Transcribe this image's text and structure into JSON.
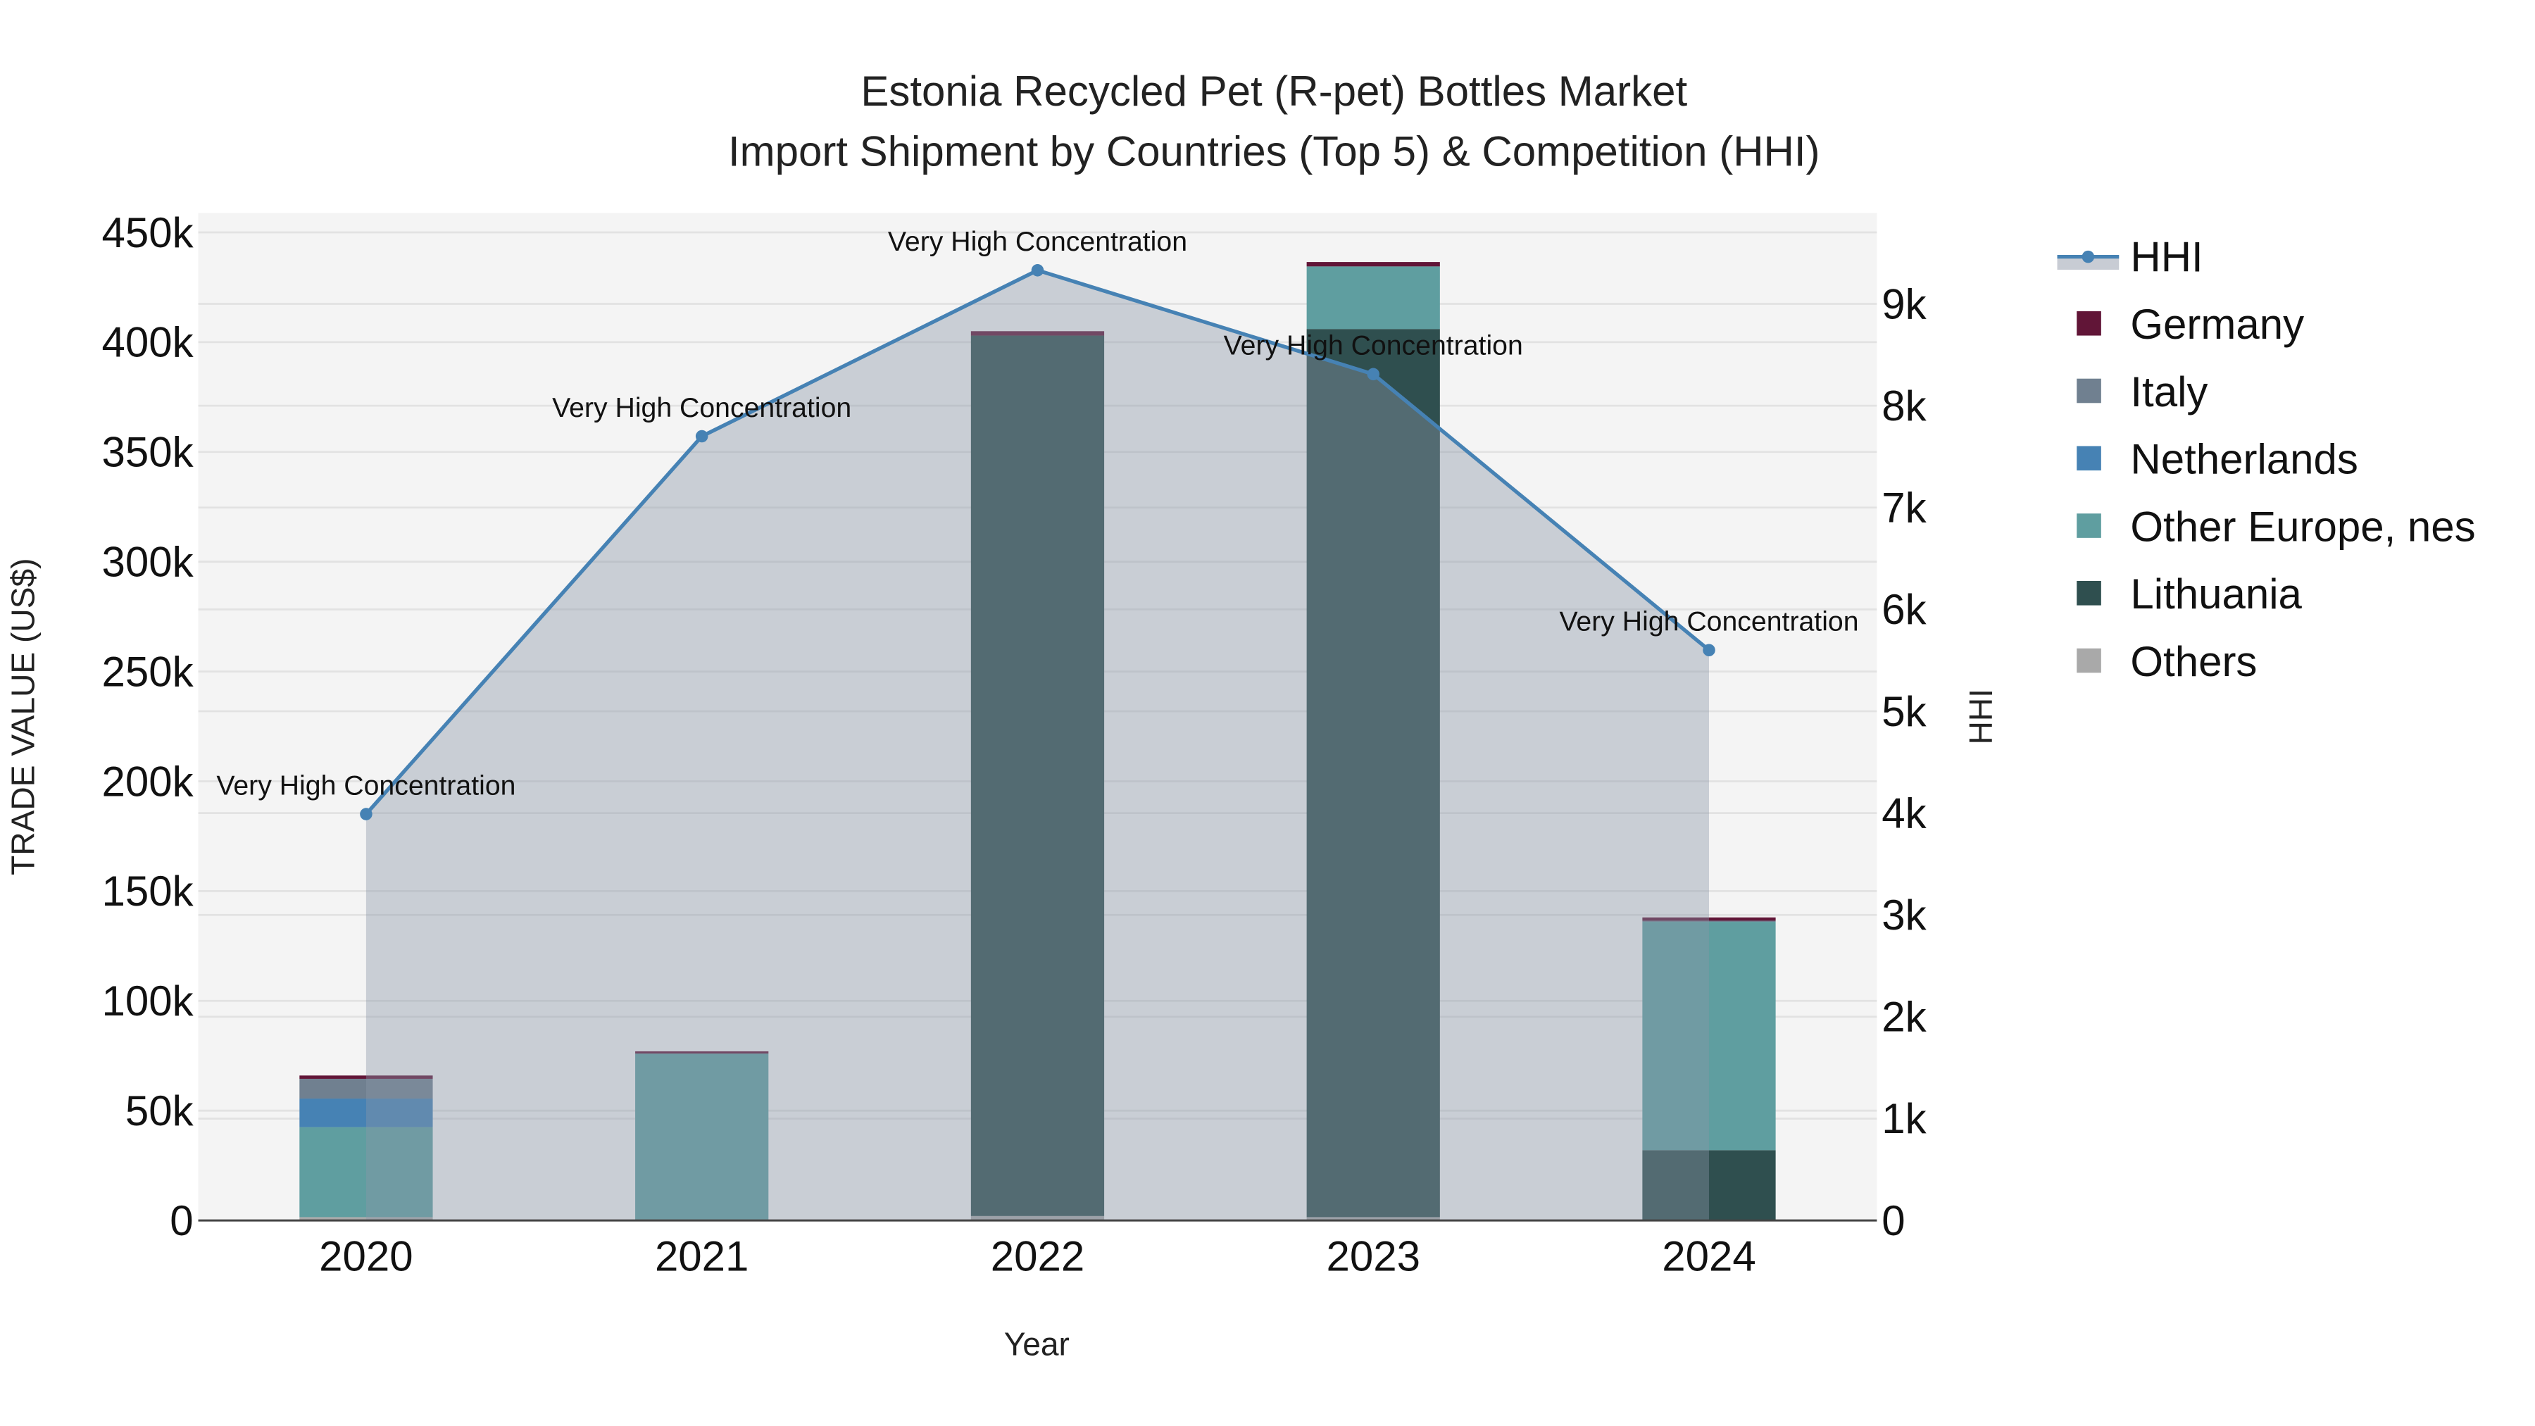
{
  "chart_data": {
    "type": "bar",
    "title": [
      "Estonia Recycled Pet (R-pet) Bottles Market",
      "Import Shipment by Countries (Top 5) & Competition (HHI)"
    ],
    "xlabel": "Year",
    "ylabel": "TRADE VALUE (US$)",
    "y2label": "HHI",
    "categories": [
      "2020",
      "2021",
      "2022",
      "2023",
      "2024"
    ],
    "ylim": [
      0,
      450000
    ],
    "y_ticks": [
      0,
      50000,
      100000,
      150000,
      200000,
      250000,
      300000,
      350000,
      400000,
      450000
    ],
    "y_tick_labels": [
      "0",
      "50k",
      "100k",
      "150k",
      "200k",
      "250k",
      "300k",
      "350k",
      "400k",
      "450k"
    ],
    "y2lim": [
      0,
      9000
    ],
    "y2_ticks": [
      0,
      1000,
      2000,
      3000,
      4000,
      5000,
      6000,
      7000,
      8000,
      9000
    ],
    "y2_tick_labels": [
      "0",
      "1k",
      "2k",
      "3k",
      "4k",
      "5k",
      "6k",
      "7k",
      "8k",
      "9k"
    ],
    "grid": true,
    "legend_position": "right",
    "stack_order": [
      "Others",
      "Lithuania",
      "Other Europe, nes",
      "Netherlands",
      "Italy",
      "Germany"
    ],
    "series": [
      {
        "name": "Germany",
        "color": "#611537",
        "values": [
          1500,
          1000,
          2000,
          2000,
          1500
        ]
      },
      {
        "name": "Italy",
        "color": "#708090",
        "values": [
          9000,
          0,
          0,
          0,
          500
        ]
      },
      {
        "name": "Netherlands",
        "color": "#4682b4",
        "values": [
          13000,
          0,
          0,
          0,
          0
        ]
      },
      {
        "name": "Other Europe, nes",
        "color": "#5f9ea0",
        "values": [
          41000,
          75500,
          0,
          28500,
          104000
        ]
      },
      {
        "name": "Lithuania",
        "color": "#2f4f4f",
        "values": [
          0,
          0,
          401000,
          404500,
          32000
        ]
      },
      {
        "name": "Others",
        "color": "#a9a9a9",
        "values": [
          1500,
          500,
          2000,
          1500,
          0
        ]
      }
    ],
    "hhi": {
      "name": "HHI",
      "color": "#4682b4",
      "values": [
        3990,
        7700,
        9330,
        8310,
        5600
      ],
      "annotations": [
        "Very High Concentration",
        "Very High Concentration",
        "Very High Concentration",
        "Very High Concentration",
        "Very High Concentration"
      ]
    }
  }
}
